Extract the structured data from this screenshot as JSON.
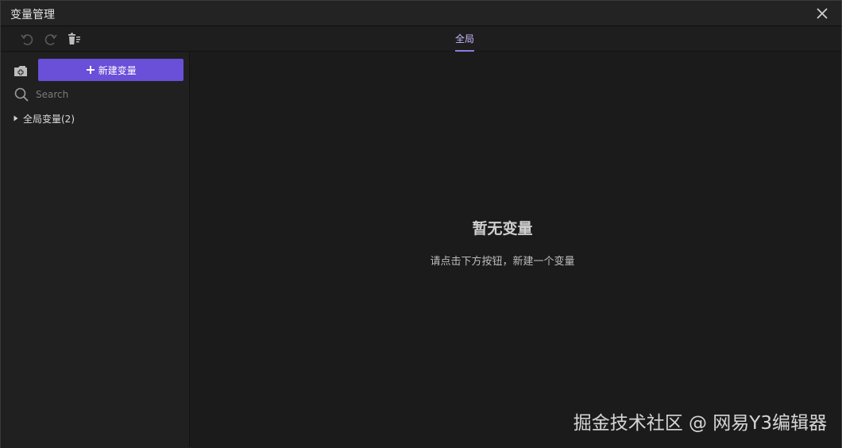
{
  "window": {
    "title": "变量管理"
  },
  "toolbar": {
    "tabs": [
      {
        "label": "全局",
        "active": true
      }
    ]
  },
  "sidebar": {
    "new_button_label": "新建变量",
    "search_placeholder": "Search",
    "tree": [
      {
        "label": "全局变量(2)",
        "expanded": false
      }
    ]
  },
  "main": {
    "empty_title": "暂无变量",
    "empty_hint": "请点击下方按钮，新建一个变量"
  },
  "watermark": {
    "text": "掘金技术社区 @ 网易Y3编辑器"
  },
  "colors": {
    "accent": "#6a4fd8",
    "tab_active": "#c9b8ff",
    "background": "#1b1b1b",
    "sidebar": "#202020"
  }
}
